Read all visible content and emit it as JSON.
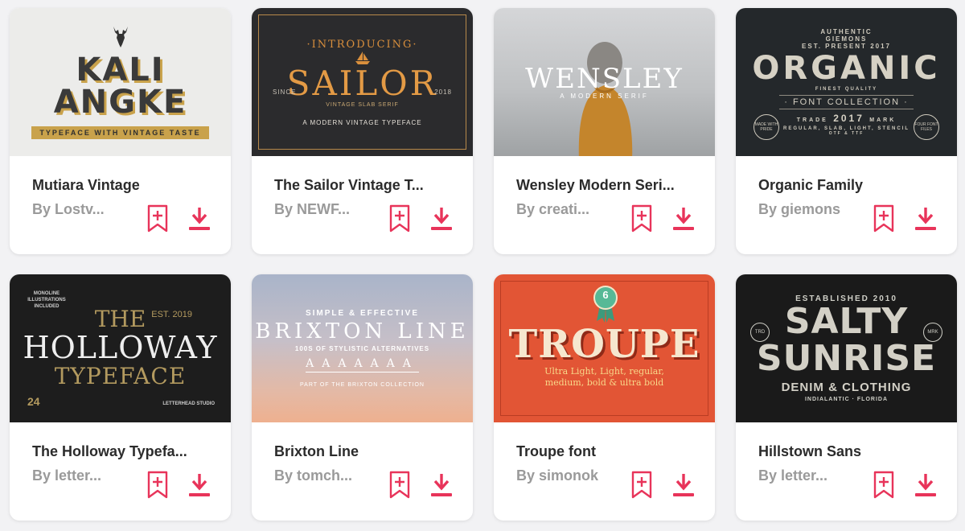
{
  "colors": {
    "accent": "#e8345a",
    "title": "#2b2b2b",
    "author": "#9a9a9a"
  },
  "cards": [
    {
      "title": "Mutiara Vintage",
      "author": "By Lostv...",
      "thumb": {
        "line1": "KALI",
        "line2": "ANGKE",
        "tagline": "TYPEFACE WITH VINTAGE TASTE",
        "icon": "deer-head-icon"
      }
    },
    {
      "title": "The Sailor Vintage T...",
      "author": "By NEWF...",
      "thumb": {
        "intro": "·INTRODUCING·",
        "big": "SAILOR",
        "since": "SINCE",
        "year": "2018",
        "sub": "VINTAGE SLAB SERIF",
        "tagline": "A MODERN VINTAGE TYPEFACE",
        "icon": "sailboat-icon"
      }
    },
    {
      "title": "Wensley Modern Seri...",
      "author": "By creati...",
      "thumb": {
        "big": "WENSLEY",
        "sub": "A MODERN SERIF"
      }
    },
    {
      "title": "Organic Family",
      "author": "By giemons",
      "thumb": {
        "top1": "AUTHENTIC",
        "top2": "GIEMONS",
        "est": "EST.",
        "present": "PRESENT",
        "year_r": "2017",
        "big": "ORGANIC",
        "finest": "FINEST",
        "quality": "QUALITY",
        "collection": "· FONT COLLECTION ·",
        "trade": "TRADE",
        "year": "2017",
        "mark": "MARK",
        "styles": "REGULAR, SLAB, LIGHT, STENCIL",
        "formats": "OTF & TTF",
        "badge_l": "MADE WITH PRIDE",
        "badge_r": "FOUR FONT FILES"
      }
    },
    {
      "title": "The Holloway Typefa...",
      "author": "By letter...",
      "thumb": {
        "the": "THE",
        "big": "HOLLOWAY",
        "type": "TYPEFACE",
        "est": "EST. 2019",
        "extras": "MONOLINE ILLUSTRATIONS INCLUDED",
        "editable": "24",
        "studio": "LETTERHEAD STUDIO"
      }
    },
    {
      "title": "Brixton Line",
      "author": "By tomch...",
      "thumb": {
        "top": "SIMPLE & EFFECTIVE",
        "big": "BRIXTON LINE",
        "alt": "100S OF STYLISTIC ALTERNATIVES",
        "sample": "AAAAAAA",
        "part": "PART OF THE BRIXTON COLLECTION"
      }
    },
    {
      "title": "Troupe font",
      "author": "By simonok",
      "thumb": {
        "badge": "6",
        "big": "TROUPE",
        "sub1": "Ultra Light, Light, regular,",
        "sub2": "medium, bold & ultra bold"
      }
    },
    {
      "title": "Hillstown Sans",
      "author": "By letter...",
      "thumb": {
        "established": "ESTABLISHED 2010",
        "line1": "SALTY",
        "line2": "SUNRISE",
        "denim": "DENIM & CLOTHING",
        "loc": "INDIALANTIC · FLORIDA",
        "badge_l": "TRD",
        "badge_r": "MRK"
      }
    }
  ]
}
